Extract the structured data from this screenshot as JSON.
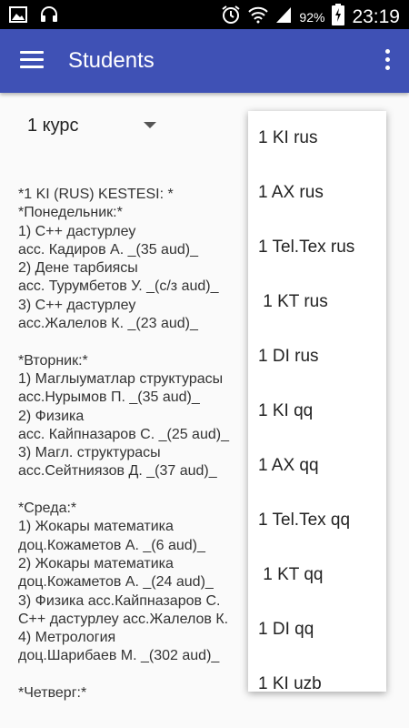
{
  "status_bar": {
    "battery": "92%",
    "time": "23:19",
    "icons": [
      "image-icon",
      "headphones-icon",
      "alarm-icon",
      "wifi-icon",
      "signal-icon",
      "battery-charging-icon"
    ]
  },
  "app_bar": {
    "title": "Students",
    "background": "#3f51b5"
  },
  "spinner": {
    "selected": "1 курс"
  },
  "schedule_text": "*1 KI (RUS) KESTESI: *\n*Понедельник:*\n1) C++ дастурлеу\nасс. Кадиров А. _(35 aud)_\n2) Дене тарбиясы\nасс. Турумбетов У. _(с/з aud)_\n3) C++ дастурлеу\nасс.Жалелов К. _(23 aud)_\n\n*Вторник:*\n1) Маглыуматлар структурасы\nасс.Нурымов П. _(35 aud)_\n2) Физика\nасс. Кайпназаров С. _(25 aud)_\n3) Магл. структурасы\nасс.Сейтниязов Д. _(37 aud)_\n\n*Среда:*\n1) Жокары математика\nдоц.Кожаметов А. _(6 aud)_\n2) Жокары математика\nдоц.Кожаметов А. _(24 aud)_\n3) Физика асс.Кайпназаров С.\nC++ дастурлеу асс.Жалелов К.\n4) Метрология\nдоц.Шарибаев М. _(302 aud)_\n\n*Четверг:*",
  "dropdown": {
    "items": [
      "1 KI rus",
      "1 AX rus",
      "1 Tel.Tex rus",
      " 1 KT rus",
      "1 DI rus",
      "1 KI qq",
      "1 AX qq",
      "1 Tel.Tex qq",
      " 1 KT qq",
      "1 DI qq",
      "1 KI uzb"
    ]
  }
}
